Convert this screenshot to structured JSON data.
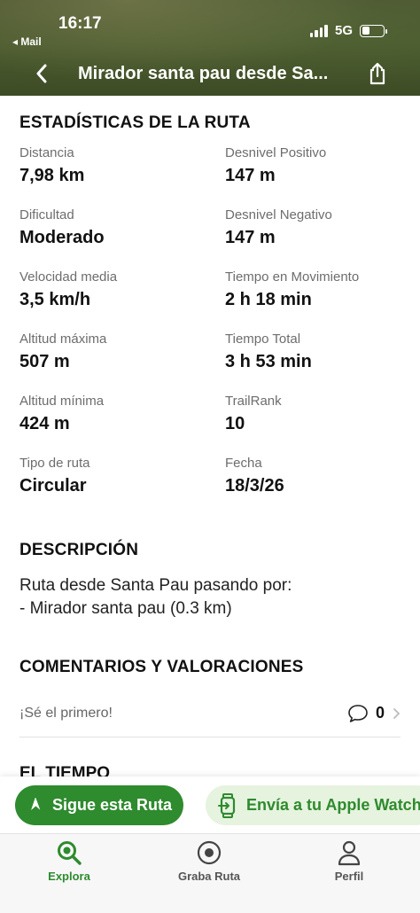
{
  "status_bar": {
    "time": "16:17",
    "back_app": "◂ Mail",
    "network": "5G",
    "battery_level": 0.35
  },
  "nav": {
    "title": "Mirador santa pau desde Sa..."
  },
  "stats_section": {
    "title": "ESTADÍSTICAS DE LA RUTA",
    "items": [
      {
        "label": "Distancia",
        "value": "7,98 km"
      },
      {
        "label": "Desnivel Positivo",
        "value": "147 m"
      },
      {
        "label": "Dificultad",
        "value": "Moderado"
      },
      {
        "label": "Desnivel Negativo",
        "value": "147 m"
      },
      {
        "label": "Velocidad media",
        "value": "3,5 km/h"
      },
      {
        "label": "Tiempo en Movimiento",
        "value": "2 h 18 min"
      },
      {
        "label": "Altitud máxima",
        "value": "507 m"
      },
      {
        "label": "Tiempo Total",
        "value": "3 h 53 min"
      },
      {
        "label": "Altitud mínima",
        "value": "424 m"
      },
      {
        "label": "TrailRank",
        "value": "10"
      },
      {
        "label": "Tipo de ruta",
        "value": "Circular"
      },
      {
        "label": "Fecha",
        "value": "18/3/26"
      }
    ]
  },
  "description": {
    "title": "DESCRIPCIÓN",
    "line1": "Ruta desde Santa Pau pasando por:",
    "line2": "- Mirador santa pau (0.3 km)"
  },
  "comments": {
    "title": "COMENTARIOS Y VALORACIONES",
    "prompt": "¡Sé el primero!",
    "count": "0"
  },
  "next_section_partial": "EL TIEMPO",
  "actions": {
    "follow_label": "Sigue esta Ruta",
    "watch_label": "Envía a tu Apple Watch"
  },
  "tabs": [
    {
      "label": "Explora",
      "active": true
    },
    {
      "label": "Graba Ruta",
      "active": false
    },
    {
      "label": "Perfil",
      "active": false
    }
  ],
  "colors": {
    "accent": "#2e8b2e",
    "accent_light": "#e6f3df",
    "header": "#4a5a2e"
  }
}
